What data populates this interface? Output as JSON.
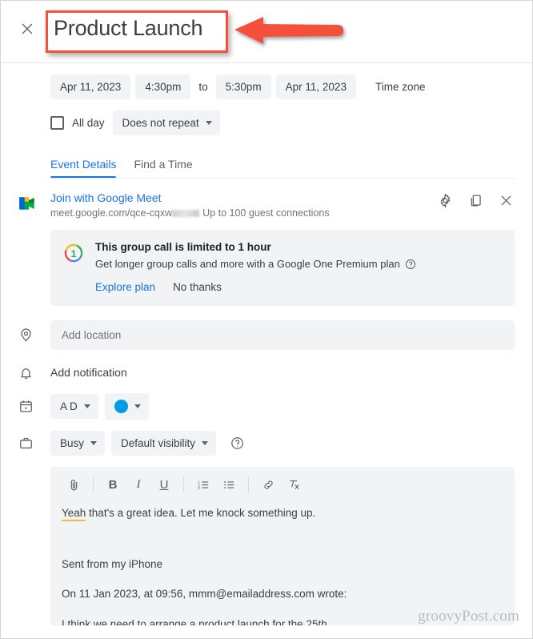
{
  "header": {
    "close_icon": "close-icon",
    "title": "Product Launch",
    "annotation": "red-left-arrow"
  },
  "schedule": {
    "start_date": "Apr 11, 2023",
    "start_time": "4:30pm",
    "to_label": "to",
    "end_time": "5:30pm",
    "end_date": "Apr 11, 2023",
    "timezone_label": "Time zone",
    "all_day_label": "All day",
    "repeat_label": "Does not repeat"
  },
  "tabs": [
    {
      "label": "Event Details",
      "active": true
    },
    {
      "label": "Find a Time",
      "active": false
    }
  ],
  "meet": {
    "icon": "google-meet-icon",
    "join_label": "Join with Google Meet",
    "url": "meet.google.com/qce-cqxw",
    "guests_label": "Up to 100 guest connections",
    "settings_icon": "gear-icon",
    "copy_icon": "copy-icon",
    "close_icon": "close-icon"
  },
  "promo": {
    "icon": "google-one-icon",
    "title": "This group call is limited to 1 hour",
    "description": "Get longer group calls and more with a Google One Premium plan",
    "help_icon": "help-circle-icon",
    "primary_action": "Explore plan",
    "secondary_action": "No thanks"
  },
  "location": {
    "icon": "location-pin-icon",
    "placeholder": "Add location"
  },
  "notification": {
    "icon": "bell-icon",
    "label": "Add notification"
  },
  "calendar": {
    "icon": "calendar-icon",
    "owner": "A D",
    "color_hex": "#039be5"
  },
  "availability": {
    "icon": "briefcase-icon",
    "busy_label": "Busy",
    "visibility_label": "Default visibility",
    "help_icon": "help-circle-icon"
  },
  "description": {
    "icon": "description-lines-icon",
    "toolbar": [
      {
        "name": "attach-icon",
        "glyph": "attach"
      },
      {
        "name": "bold-icon",
        "glyph": "B"
      },
      {
        "name": "italic-icon",
        "glyph": "I"
      },
      {
        "name": "underline-icon",
        "glyph": "U"
      },
      {
        "name": "numbered-list-icon",
        "glyph": "ol"
      },
      {
        "name": "bulleted-list-icon",
        "glyph": "ul"
      },
      {
        "name": "link-icon",
        "glyph": "link"
      },
      {
        "name": "clear-formatting-icon",
        "glyph": "clear"
      }
    ],
    "line_1_misspelled": "Yeah",
    "line_1_rest": " that's a great idea. Let me knock something up.",
    "line_2": "Sent from my iPhone",
    "line_3": "On 11 Jan 2023, at 09:56, mmm@emailaddress.com wrote:",
    "line_4": "I think we need to arrange a product launch for the 25th"
  },
  "watermark": "groovyPost.com",
  "colors": {
    "accent_blue": "#1a73e8",
    "chip_grey": "#f1f3f4",
    "text_primary": "#3c4043",
    "text_secondary": "#70757a",
    "annotation_red": "#f4503c"
  }
}
